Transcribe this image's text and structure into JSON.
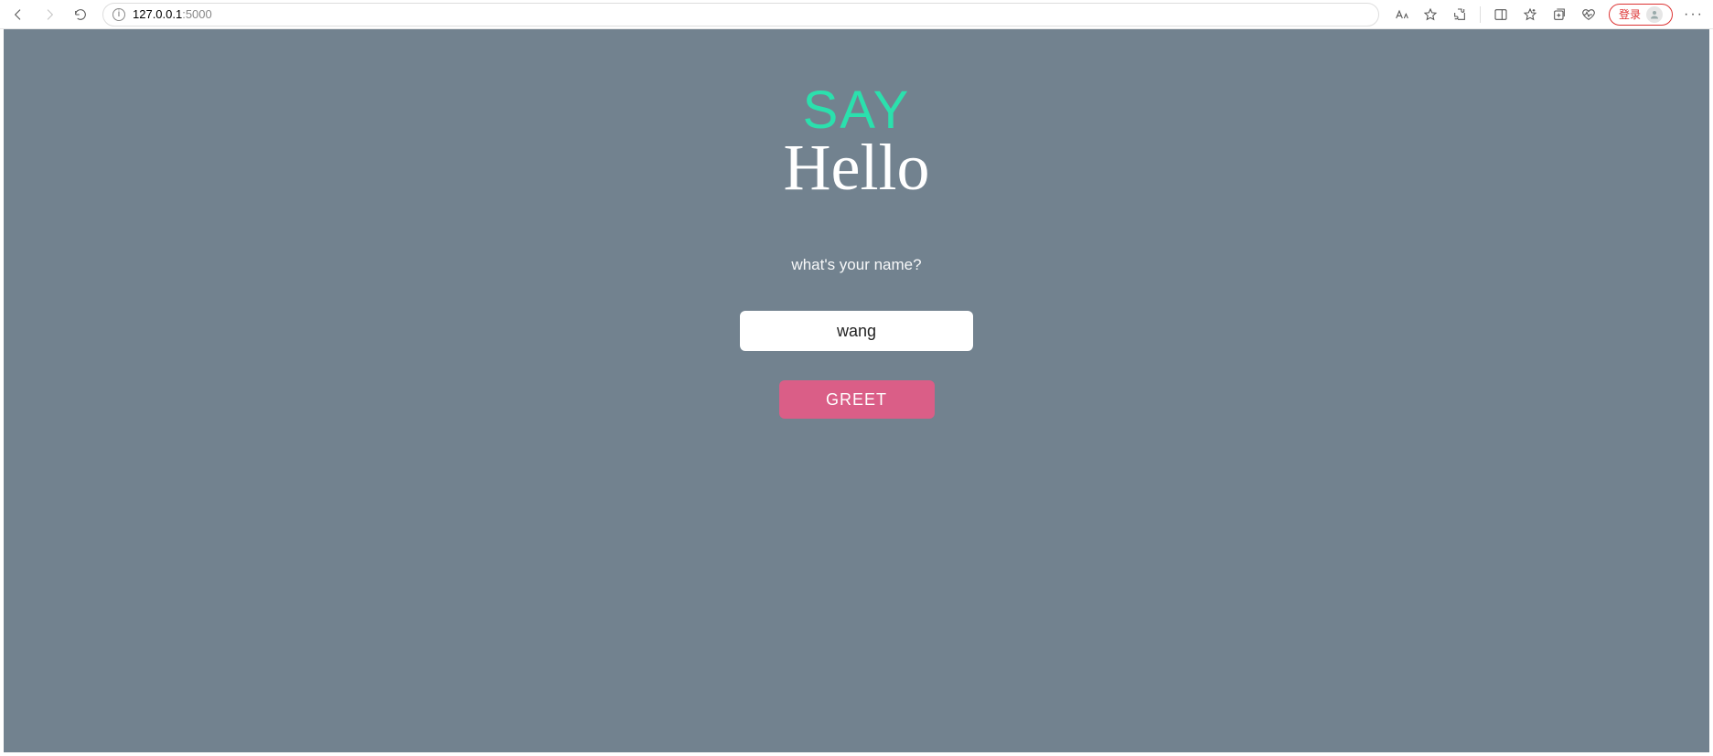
{
  "browser": {
    "url_host": "127.0.0.1",
    "url_port": ":5000",
    "login_label": "登录"
  },
  "page": {
    "logo_top": "SAY",
    "logo_bottom": "Hello",
    "prompt": "what's your name?",
    "name_value": "wang",
    "greet_label": "GREET"
  },
  "colors": {
    "page_bg": "#72828f",
    "accent_green": "#2be0ad",
    "button_pink": "#da5e87"
  }
}
